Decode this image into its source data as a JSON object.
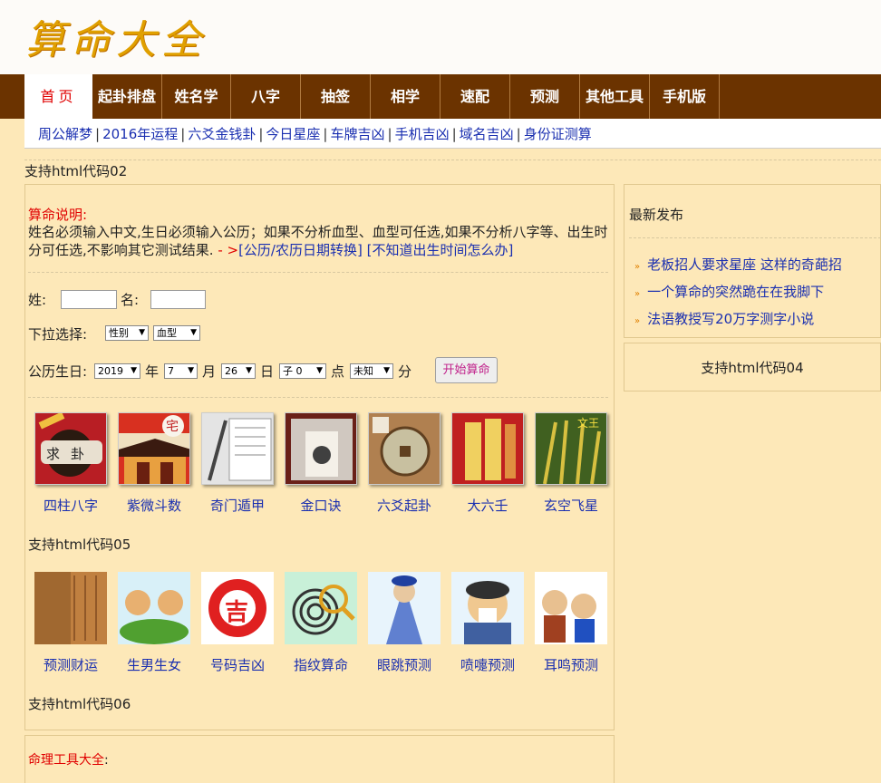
{
  "site": {
    "logo": "算命大全"
  },
  "nav": [
    "首页",
    "起卦排盘",
    "姓名学",
    "八字",
    "抽签",
    "相学",
    "速配",
    "预测",
    "其他工具",
    "手机版"
  ],
  "subnav": [
    "周公解梦",
    "2016年运程",
    "六爻金钱卦",
    "今日星座",
    "车牌吉凶",
    "手机吉凶",
    "域名吉凶",
    "身份证测算"
  ],
  "support": {
    "code02": "支持html代码02",
    "code04": "支持html代码04",
    "code05": "支持html代码05",
    "code06": "支持html代码06"
  },
  "notice": {
    "title": "算命说明:",
    "text": "姓名必须输入中文,生日必须输入公历；如果不分析血型、血型可任选,如果不分析八字等、出生时分可任选,不影响其它测试结果.",
    "arrow": "- >",
    "link1": "[公历/农历日期转换]",
    "link2": "[不知道出生时间怎么办]"
  },
  "form": {
    "surname_label": "姓:",
    "name_label": "名:",
    "dropdown_label": "下拉选择:",
    "gender": "性别",
    "blood": "血型",
    "birthday_label": "公历生日:",
    "year": "2019",
    "year_unit": "年",
    "month": "7",
    "month_unit": "月",
    "day": "26",
    "day_unit": "日",
    "hour": "子 0",
    "hour_unit": "点",
    "minute": "未知",
    "minute_unit": "分",
    "submit": "开始算命"
  },
  "tools_row1": [
    "四柱八字",
    "紫微斗数",
    "奇门遁甲",
    "金口诀",
    "六爻起卦",
    "大六壬",
    "玄空飞星"
  ],
  "tools_row2": [
    "预测财运",
    "生男生女",
    "号码吉凶",
    "指纹算命",
    "眼跳预测",
    "喷嚏预测",
    "耳鸣预测"
  ],
  "tool_tile_text": {
    "sizhu": "求卦",
    "ziwei": "宅",
    "xuankong": "文王",
    "haoma": "吉"
  },
  "latest": {
    "title": "最新发布",
    "items": [
      "老板招人要求星座 这样的奇葩招",
      "一个算命的突然跪在在我脚下",
      "法语教授写20万字测字小说"
    ]
  },
  "bottom": {
    "title": "命理工具大全",
    "colon": ":"
  },
  "colors": {
    "nav_bg": "#6b3300",
    "page_bg": "#fde8b8",
    "link": "#1a2fb0",
    "accent_red": "#e00000"
  }
}
